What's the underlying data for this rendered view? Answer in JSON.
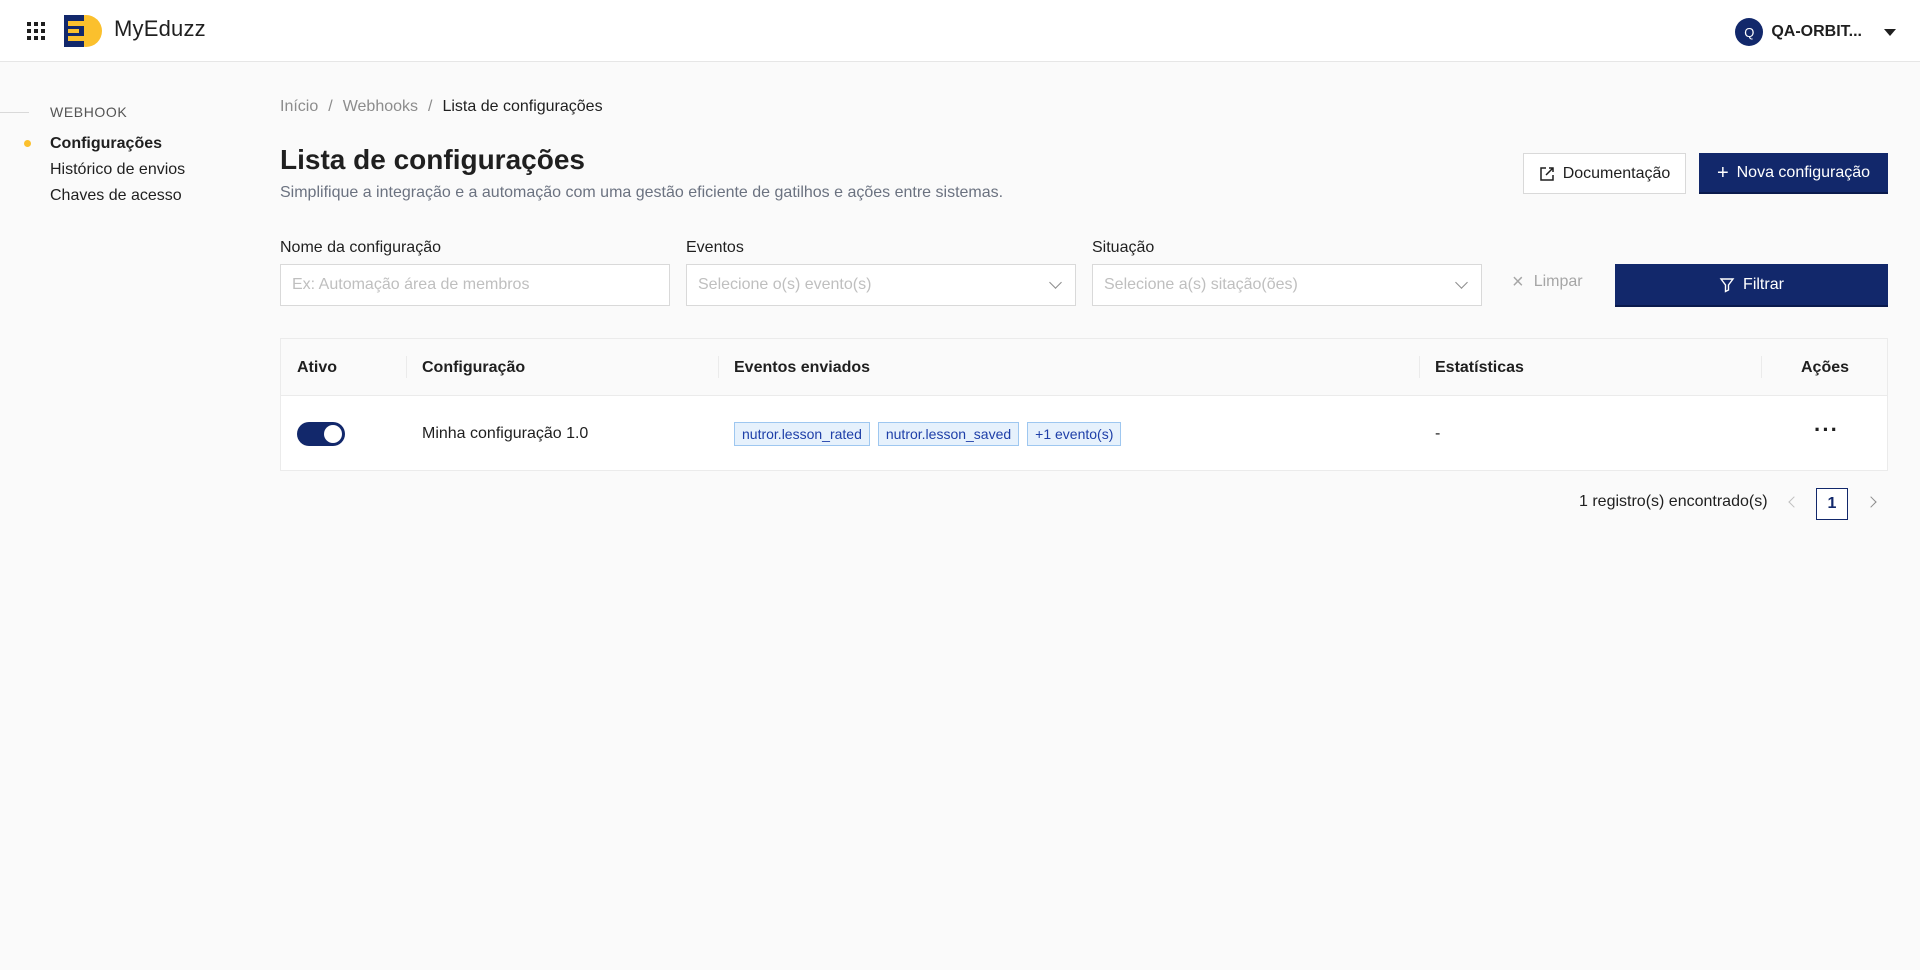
{
  "header": {
    "brand": "MyEduzz",
    "user_initial": "Q",
    "user_name": "QA-ORBIT...",
    "colors": {
      "primary": "#12286b",
      "accent": "#fbc02d"
    }
  },
  "sidebar": {
    "section": "WEBHOOK",
    "items": [
      {
        "label": "Configurações",
        "active": true
      },
      {
        "label": "Histórico de envios"
      },
      {
        "label": "Chaves de acesso"
      }
    ]
  },
  "breadcrumb": {
    "items": [
      "Início",
      "Webhooks"
    ],
    "current": "Lista de configurações"
  },
  "page": {
    "title": "Lista de configurações",
    "subtitle": "Simplifique a integração e a automação com uma gestão eficiente de gatilhos e ações entre sistemas.",
    "doc_button": "Documentação",
    "new_button": "Nova configuração"
  },
  "filters": {
    "name_label": "Nome da configuração",
    "name_placeholder": "Ex: Automação área de membros",
    "events_label": "Eventos",
    "events_placeholder": "Selecione o(s) evento(s)",
    "status_label": "Situação",
    "status_placeholder": "Selecione a(s) sitação(ões)",
    "clear_button": "Limpar",
    "filter_button": "Filtrar"
  },
  "table": {
    "columns": [
      "Ativo",
      "Configuração",
      "Eventos enviados",
      "Estatísticas",
      "Ações"
    ],
    "rows": [
      {
        "active": true,
        "name": "Minha configuração 1.0",
        "events": [
          "nutror.lesson_rated",
          "nutror.lesson_saved",
          "+1 evento(s)"
        ],
        "stats": "-",
        "actions": "···"
      }
    ]
  },
  "pagination": {
    "records": "1 registro(s) encontrado(s)",
    "current_page": "1"
  }
}
